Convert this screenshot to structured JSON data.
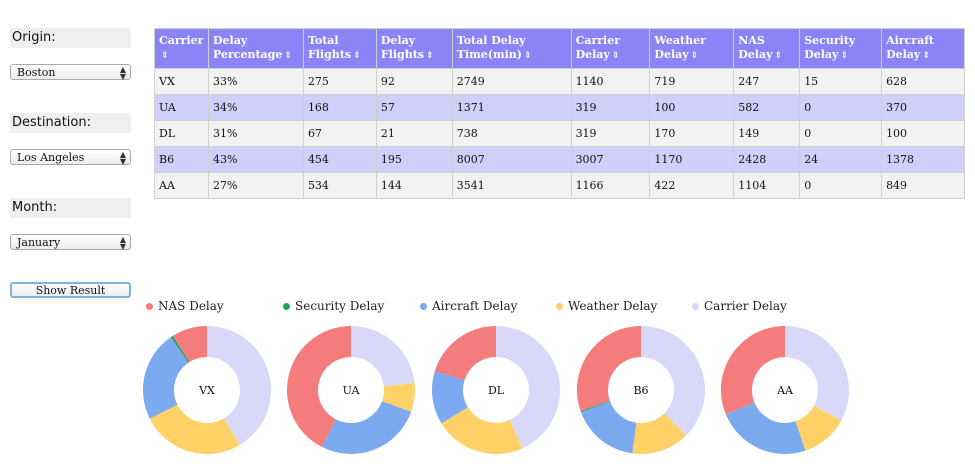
{
  "filters": {
    "origin_label": "Origin:",
    "origin_value": "Boston",
    "destination_label": "Destination:",
    "destination_value": "Los Angeles",
    "month_label": "Month:",
    "month_value": "January",
    "show_button": "Show Result"
  },
  "table": {
    "sort_icon": "sort-icon",
    "headers": [
      [
        "Carrier"
      ],
      [
        "Delay",
        "Percentage"
      ],
      [
        "Total",
        "Flights"
      ],
      [
        "Delay",
        "Flights"
      ],
      [
        "Total Delay",
        "Time(min)"
      ],
      [
        "Carrier",
        "Delay"
      ],
      [
        "Weather",
        "Delay"
      ],
      [
        "NAS",
        "Delay"
      ],
      [
        "Security",
        "Delay"
      ],
      [
        "Aircraft",
        "Delay"
      ]
    ],
    "rows": [
      [
        "VX",
        "33%",
        "275",
        "92",
        "2749",
        "1140",
        "719",
        "247",
        "15",
        "628"
      ],
      [
        "UA",
        "34%",
        "168",
        "57",
        "1371",
        "319",
        "100",
        "582",
        "0",
        "370"
      ],
      [
        "DL",
        "31%",
        "67",
        "21",
        "738",
        "319",
        "170",
        "149",
        "0",
        "100"
      ],
      [
        "B6",
        "43%",
        "454",
        "195",
        "8007",
        "3007",
        "1170",
        "2428",
        "24",
        "1378"
      ],
      [
        "AA",
        "27%",
        "534",
        "144",
        "3541",
        "1166",
        "422",
        "1104",
        "0",
        "849"
      ]
    ]
  },
  "chart_data": {
    "type": "pie",
    "series": [
      {
        "name": "NAS Delay",
        "color": "#f47c7c"
      },
      {
        "name": "Security Delay",
        "color": "#1aa55c"
      },
      {
        "name": "Aircraft Delay",
        "color": "#7baaf0"
      },
      {
        "name": "Weather Delay",
        "color": "#ffd166"
      },
      {
        "name": "Carrier Delay",
        "color": "#d8d8f8"
      }
    ],
    "legend_placement": "top",
    "charts": [
      {
        "label": "VX",
        "values": [
          247,
          15,
          628,
          719,
          1140
        ]
      },
      {
        "label": "UA",
        "values": [
          582,
          0,
          370,
          100,
          319
        ]
      },
      {
        "label": "DL",
        "values": [
          149,
          0,
          100,
          170,
          319
        ]
      },
      {
        "label": "B6",
        "values": [
          2428,
          24,
          1378,
          1170,
          3007
        ]
      },
      {
        "label": "AA",
        "values": [
          1104,
          0,
          849,
          422,
          1166
        ]
      }
    ]
  }
}
